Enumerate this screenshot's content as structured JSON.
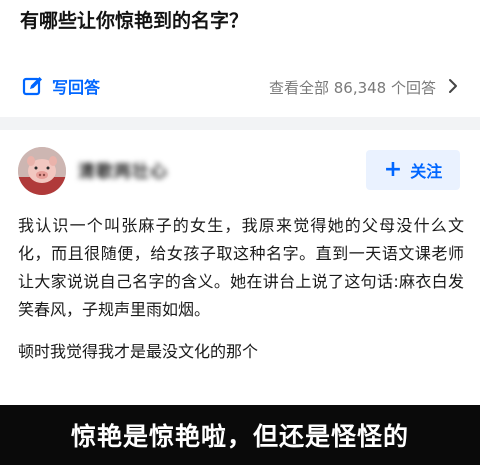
{
  "question": {
    "title": "有哪些让你惊艳到的名字？",
    "write_answer_label": "写回答",
    "view_all_label": "查看全部 86,348 个回答"
  },
  "answer": {
    "author_name": "清歌两壮心",
    "follow_label": "关注",
    "paragraphs": [
      "我认识一个叫张麻子的女生，我原来觉得她的父母没什么文化，而且很随便，给女孩子取这种名字。直到一天语文课老师让大家说说自己名字的含义。她在讲台上说了这句话:麻衣白发笑春风，子规声里雨如烟。",
      "顿时我觉得我才是最没文化的那个"
    ]
  },
  "caption": {
    "text": "惊艳是惊艳啦，但还是怪怪的"
  },
  "icons": {
    "write": "edit-square-icon",
    "chevron": "chevron-right-icon",
    "plus": "plus-icon",
    "avatar": "pig-avatar"
  },
  "colors": {
    "accent": "#0066ff",
    "follow_bg": "#eaf2ff",
    "divider": "#f2f3f5",
    "caption_bg": "#0a0a0a"
  }
}
